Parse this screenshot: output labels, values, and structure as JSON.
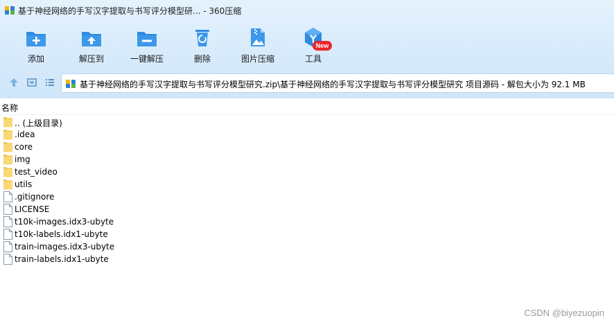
{
  "window": {
    "title": "基于神经网络的手写汉字提取与书写评分模型研... - 360压缩"
  },
  "toolbar": {
    "items": [
      {
        "label": "添加",
        "icon": "add-folder-icon"
      },
      {
        "label": "解压到",
        "icon": "extract-to-folder-icon"
      },
      {
        "label": "一键解压",
        "icon": "one-click-extract-icon"
      },
      {
        "label": "删除",
        "icon": "recycle-bin-icon"
      },
      {
        "label": "图片压缩",
        "icon": "image-compress-icon"
      },
      {
        "label": "工具",
        "icon": "tools-cube-icon"
      }
    ],
    "badge": "New"
  },
  "address": {
    "path": "基于神经网络的手写汉字提取与书写评分模型研究.zip\\基于神经网络的手写汉字提取与书写评分模型研究 项目源码 - 解包大小为 92.1 MB"
  },
  "file_list": {
    "column_header": "名称",
    "items": [
      {
        "name": ".. (上级目录)",
        "type": "folder"
      },
      {
        "name": ".idea",
        "type": "folder"
      },
      {
        "name": "core",
        "type": "folder"
      },
      {
        "name": "img",
        "type": "folder"
      },
      {
        "name": "test_video",
        "type": "folder"
      },
      {
        "name": "utils",
        "type": "folder"
      },
      {
        "name": ".gitignore",
        "type": "file"
      },
      {
        "name": "LICENSE",
        "type": "file"
      },
      {
        "name": "t10k-images.idx3-ubyte",
        "type": "file"
      },
      {
        "name": "t10k-labels.idx1-ubyte",
        "type": "file"
      },
      {
        "name": "train-images.idx3-ubyte",
        "type": "file"
      },
      {
        "name": "train-labels.idx1-ubyte",
        "type": "file"
      }
    ]
  },
  "watermark": "CSDN @biyezuopin",
  "colors": {
    "accent_blue": "#2f8be0",
    "folder_yellow": "#f6d36b",
    "badge_red": "#e8272c"
  }
}
